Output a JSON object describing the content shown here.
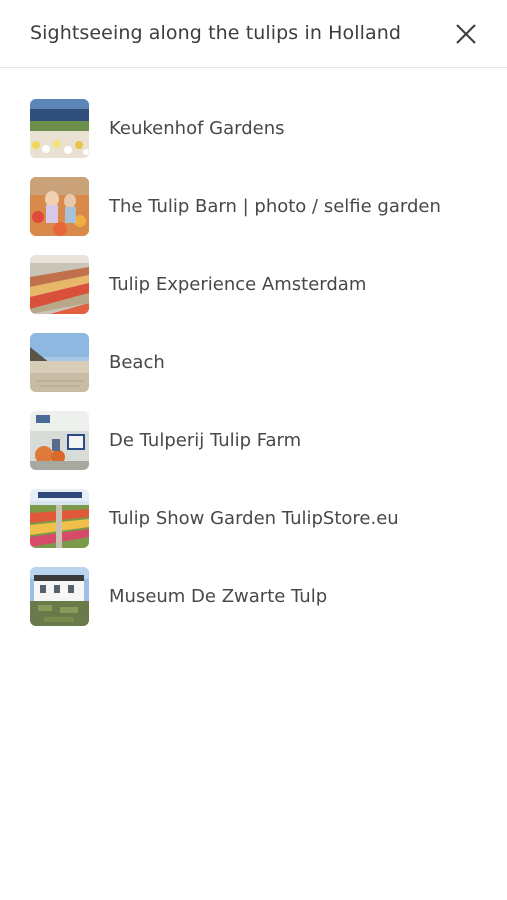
{
  "header": {
    "title": "Sightseeing along the tulips in Holland",
    "close_icon": "close-icon"
  },
  "places": [
    {
      "label": "Keukenhof Gardens",
      "thumbnail": "keukenhof-gardens-photo"
    },
    {
      "label": "The Tulip Barn | photo / selfie garden",
      "thumbnail": "tulip-barn-photo"
    },
    {
      "label": "Tulip Experience Amsterdam",
      "thumbnail": "tulip-experience-photo"
    },
    {
      "label": "Beach",
      "thumbnail": "beach-photo"
    },
    {
      "label": "De Tulperij Tulip Farm",
      "thumbnail": "tulperij-farm-photo"
    },
    {
      "label": "Tulip Show Garden TulipStore.eu",
      "thumbnail": "tulip-show-garden-photo"
    },
    {
      "label": "Museum De Zwarte Tulp",
      "thumbnail": "museum-zwarte-tulp-photo"
    }
  ]
}
